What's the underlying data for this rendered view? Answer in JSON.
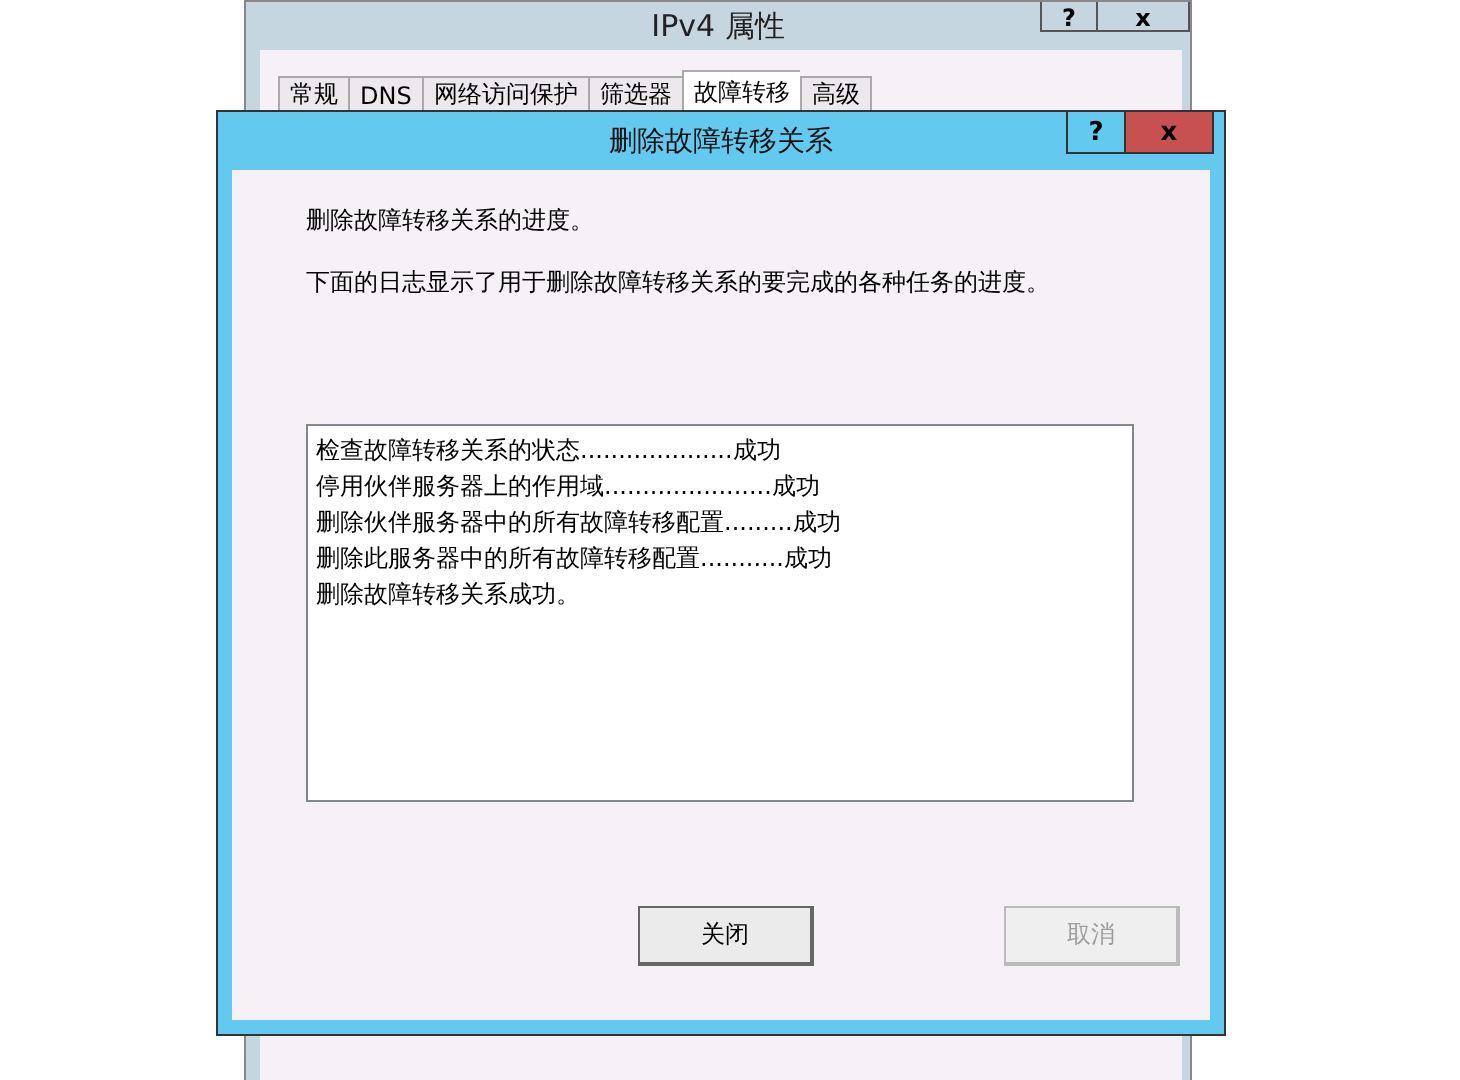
{
  "back_window": {
    "title": "IPv4 属性",
    "help": "?",
    "close": "x",
    "tabs": [
      {
        "label": "常规",
        "selected": false
      },
      {
        "label": "DNS",
        "selected": false
      },
      {
        "label": "网络访问保护",
        "selected": false
      },
      {
        "label": "筛选器",
        "selected": false
      },
      {
        "label": "故障转移",
        "selected": true
      },
      {
        "label": "高级",
        "selected": false
      }
    ]
  },
  "dialog": {
    "title": "删除故障转移关系",
    "help": "?",
    "close": "x",
    "intro": "删除故障转移关系的进度。",
    "description": "下面的日志显示了用于删除故障转移关系的要完成的各种任务的进度。",
    "log": [
      "检查故障转移关系的状态....................成功",
      "停用伙伴服务器上的作用域......................成功",
      "删除伙伴服务器中的所有故障转移配置.........成功",
      "删除此服务器中的所有故障转移配置...........成功",
      "删除故障转移关系成功。"
    ],
    "buttons": [
      {
        "label": "关闭",
        "disabled": false
      },
      {
        "label": "取消",
        "disabled": true
      }
    ]
  }
}
